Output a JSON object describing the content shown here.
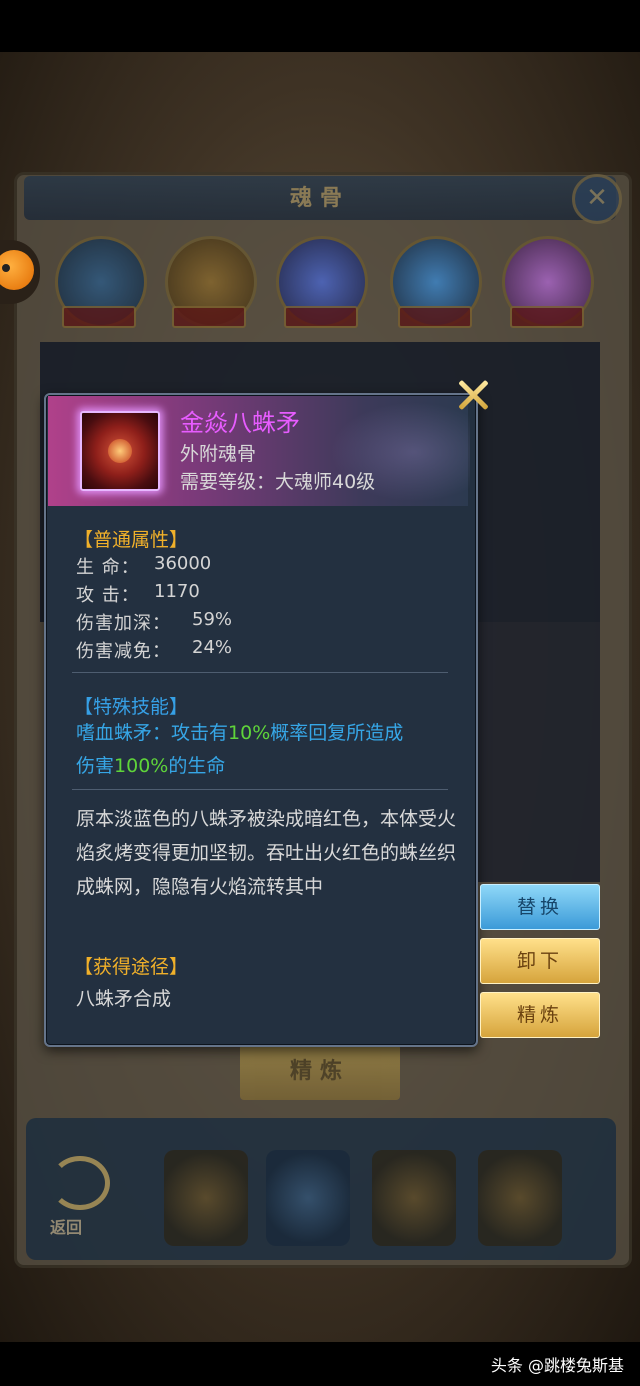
{
  "item": {
    "name": "金焱八蛛矛",
    "type": "外附魂骨",
    "requirement": "需要等级：大魂师40级"
  },
  "normal_attributes": {
    "title": "【普通属性】",
    "stats": [
      {
        "label": "生 命：",
        "value": "36000"
      },
      {
        "label": "攻 击：",
        "value": "1170"
      },
      {
        "label": "伤害加深：",
        "value": "59%"
      },
      {
        "label": "伤害减免：",
        "value": "24%"
      }
    ]
  },
  "special_skill": {
    "title": "【特殊技能】",
    "line1_prefix": "嗜血蛛矛：攻击有",
    "line1_highlight": "10%",
    "line1_suffix": "概率回复所造成",
    "line2_prefix": "伤害",
    "line2_highlight": "100%",
    "line2_suffix": "的生命"
  },
  "description": "原本淡蓝色的八蛛矛被染成暗红色，本体受火焰炙烤变得更加坚韧。吞吐出火红色的蛛丝织成蛛网，隐隐有火焰流转其中",
  "source": {
    "title": "【获得途径】",
    "text": "八蛛矛合成"
  },
  "actions": {
    "replace": "替换",
    "unload": "卸下",
    "refine": "精炼"
  },
  "background": {
    "panel_title": "魂骨",
    "refine_button": "精炼",
    "back_label": "返回"
  },
  "watermark": "头条 @跳楼兔斯基"
}
